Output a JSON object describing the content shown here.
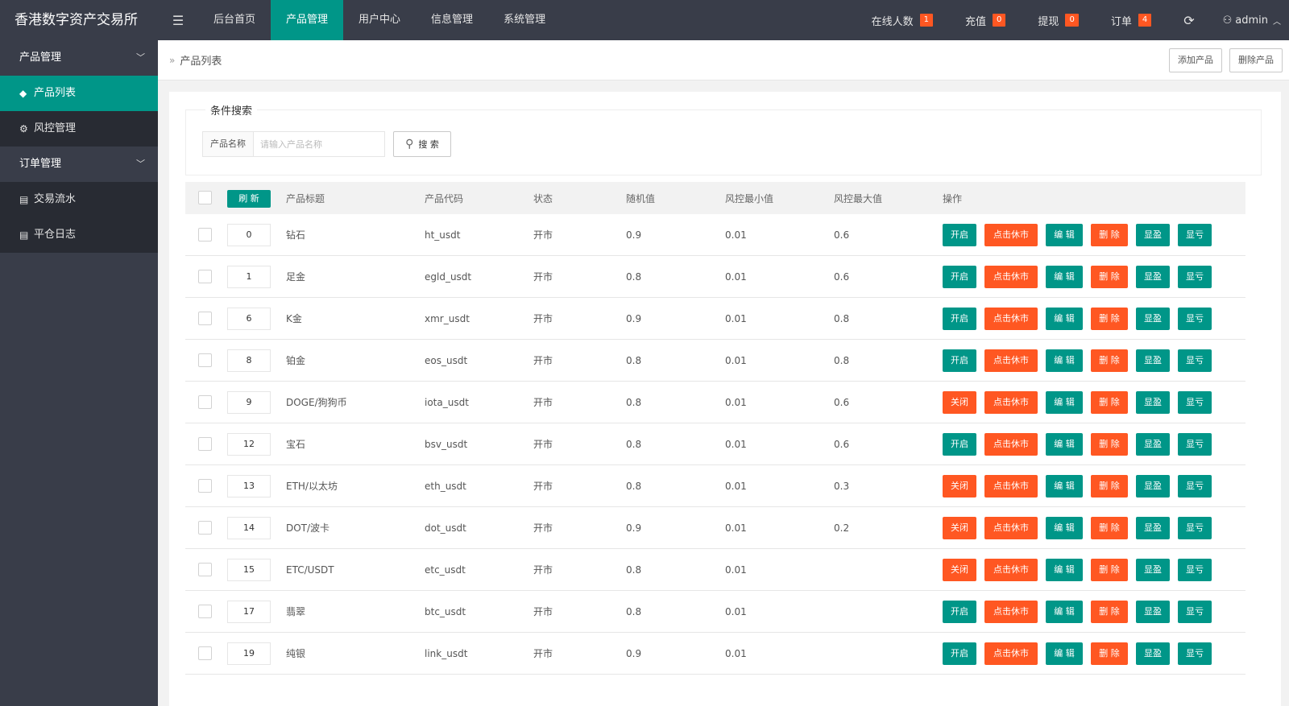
{
  "app": {
    "title": "香港数字资产交易所",
    "menu_icon": "hamburger-icon"
  },
  "topnav": [
    {
      "label": "后台首页",
      "active": false
    },
    {
      "label": "产品管理",
      "active": true
    },
    {
      "label": "用户中心",
      "active": false
    },
    {
      "label": "信息管理",
      "active": false
    },
    {
      "label": "系统管理",
      "active": false
    }
  ],
  "topright": {
    "online": {
      "label": "在线人数",
      "count": "1"
    },
    "recharge": {
      "label": "充值",
      "count": "0"
    },
    "withdraw": {
      "label": "提现",
      "count": "0"
    },
    "orders": {
      "label": "订单",
      "count": "4"
    },
    "user": "admin"
  },
  "sidebar": {
    "group1": "产品管理",
    "items1": [
      {
        "label": "产品列表",
        "icon": "cube-icon"
      },
      {
        "label": "风控管理",
        "icon": "gear-icon"
      }
    ],
    "group2": "订单管理",
    "items2": [
      {
        "label": "交易流水",
        "icon": "document-icon"
      },
      {
        "label": "平仓日志",
        "icon": "document-icon"
      }
    ]
  },
  "breadcrumb": "产品列表",
  "actions": {
    "add": "添加产品",
    "delete": "删除产品"
  },
  "search": {
    "legend": "条件搜索",
    "field_label": "产品名称",
    "placeholder": "请输入产品名称",
    "value": "",
    "button": "搜 索"
  },
  "table": {
    "refresh": "刷 新",
    "headers": {
      "title": "产品标题",
      "code": "产品代码",
      "status": "状态",
      "random": "随机值",
      "min": "风控最小值",
      "max": "风控最大值",
      "ops": "操作"
    },
    "op_labels": {
      "open": "开启",
      "close": "关闭",
      "suspend": "点击休市",
      "edit": "编 辑",
      "delete": "删 除",
      "profit": "显盈",
      "loss": "显亏"
    },
    "rows": [
      {
        "sort": "0",
        "title": "钻石",
        "code": "ht_usdt",
        "status": "开市",
        "random": "0.9",
        "min": "0.01",
        "max": "0.6",
        "toggle": "open"
      },
      {
        "sort": "1",
        "title": "足金",
        "code": "egld_usdt",
        "status": "开市",
        "random": "0.8",
        "min": "0.01",
        "max": "0.6",
        "toggle": "open"
      },
      {
        "sort": "6",
        "title": "K金",
        "code": "xmr_usdt",
        "status": "开市",
        "random": "0.9",
        "min": "0.01",
        "max": "0.8",
        "toggle": "open"
      },
      {
        "sort": "8",
        "title": "铂金",
        "code": "eos_usdt",
        "status": "开市",
        "random": "0.8",
        "min": "0.01",
        "max": "0.8",
        "toggle": "open"
      },
      {
        "sort": "9",
        "title": "DOGE/狗狗币",
        "code": "iota_usdt",
        "status": "开市",
        "random": "0.8",
        "min": "0.01",
        "max": "0.6",
        "toggle": "close"
      },
      {
        "sort": "12",
        "title": "宝石",
        "code": "bsv_usdt",
        "status": "开市",
        "random": "0.8",
        "min": "0.01",
        "max": "0.6",
        "toggle": "open"
      },
      {
        "sort": "13",
        "title": "ETH/以太坊",
        "code": "eth_usdt",
        "status": "开市",
        "random": "0.8",
        "min": "0.01",
        "max": "0.3",
        "toggle": "close"
      },
      {
        "sort": "14",
        "title": "DOT/波卡",
        "code": "dot_usdt",
        "status": "开市",
        "random": "0.9",
        "min": "0.01",
        "max": "0.2",
        "toggle": "close"
      },
      {
        "sort": "15",
        "title": "ETC/USDT",
        "code": "etc_usdt",
        "status": "开市",
        "random": "0.8",
        "min": "0.01",
        "max": "",
        "toggle": "close"
      },
      {
        "sort": "17",
        "title": "翡翠",
        "code": "btc_usdt",
        "status": "开市",
        "random": "0.8",
        "min": "0.01",
        "max": "",
        "toggle": "open"
      },
      {
        "sort": "19",
        "title": "纯银",
        "code": "link_usdt",
        "status": "开市",
        "random": "0.9",
        "min": "0.01",
        "max": "",
        "toggle": "open"
      }
    ]
  }
}
